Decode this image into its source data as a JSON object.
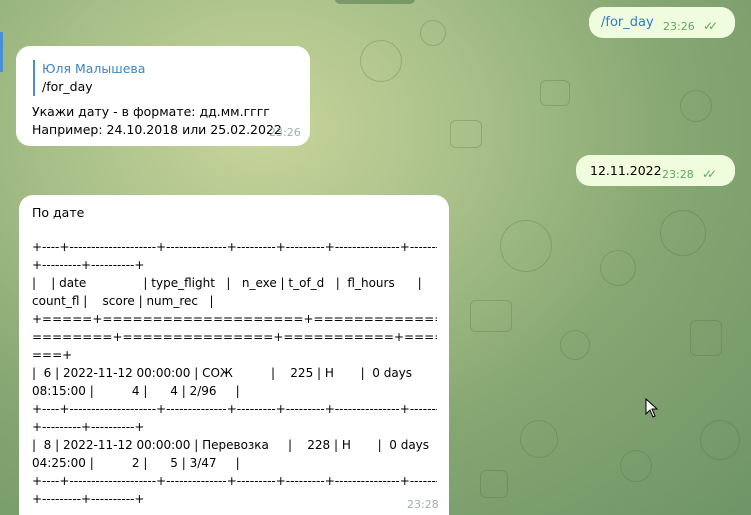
{
  "messages": {
    "cmd1": {
      "text": "/for_day",
      "time": "23:26",
      "status_icon": "double-check-icon"
    },
    "reply1": {
      "quote_author": "Юля Малышева",
      "quote_text": "/for_day",
      "line1": "Укажи дату - в формате: дд.мм.гггг",
      "line2": "Например: 24.10.2018 или 25.02.2022",
      "time": "23:26"
    },
    "date_msg": {
      "text": "12.11.2022",
      "time": "23:28",
      "status_icon": "double-check-icon"
    },
    "result": {
      "title": "По дате",
      "lines": [
        "+----+--------------------+--------------+---------+---------+---------------+-----------",
        "+---------+----------+",
        "|    | date               | type_flight   |   n_exe | t_of_d   |  fl_hours      |",
        "count_fl |    score | num_rec   |",
        "+=====+====================+==============+=========+===",
        "========+===============+===========+=========+==========",
        "===+",
        "|  6 | 2022-11-12 00:00:00 | СОЖ          |    225 | Н       |  0 days",
        "08:15:00 |          4 |      4 | 2/96     |",
        "+----+--------------------+--------------+---------+---------+---------------+-----------",
        "+---------+----------+",
        "|  8 | 2022-11-12 00:00:00 | Перевозка     |    228 | Н       |  0 days",
        "04:25:00 |          2 |      5 | 3/47     |",
        "+----+--------------------+--------------+---------+---------+---------------+-----------",
        "+---------+----------+"
      ],
      "time": "23:28"
    }
  },
  "colors": {
    "outgoing_bubble": "#effdde",
    "incoming_bubble": "#ffffff",
    "link": "#2f7cc4",
    "timestamp_out": "#5fa95a",
    "quote_bar": "#4a8fd6"
  }
}
